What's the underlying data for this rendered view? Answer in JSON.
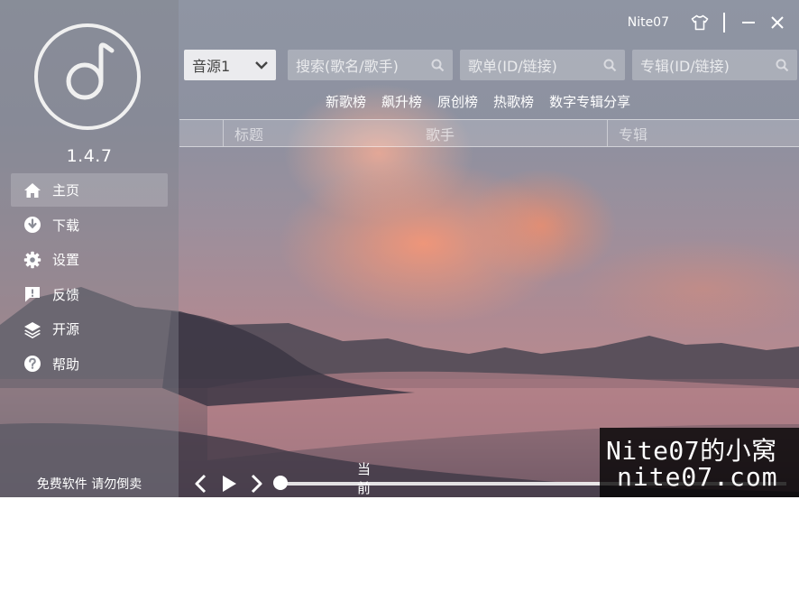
{
  "app": {
    "version": "1.4.7",
    "footer_note": "免费软件 请勿倒卖",
    "accent": "#ffffff"
  },
  "sidebar": {
    "items": [
      {
        "label": "主页",
        "icon": "home-icon",
        "active": true
      },
      {
        "label": "下载",
        "icon": "download-icon",
        "active": false
      },
      {
        "label": "设置",
        "icon": "gear-icon",
        "active": false
      },
      {
        "label": "反馈",
        "icon": "feedback-icon",
        "active": false
      },
      {
        "label": "开源",
        "icon": "layers-icon",
        "active": false
      },
      {
        "label": "帮助",
        "icon": "help-icon",
        "active": false
      }
    ]
  },
  "titlebar": {
    "username": "Nite07"
  },
  "search": {
    "source_value": "音源1",
    "song_placeholder": "搜索(歌名/歌手)",
    "playlist_placeholder": "歌单(ID/链接)",
    "album_placeholder": "专辑(ID/链接)"
  },
  "charts": [
    "新歌榜",
    "飙升榜",
    "原创榜",
    "热歌榜",
    "数字专辑分享"
  ],
  "table": {
    "columns": [
      "标题",
      "歌手",
      "专辑"
    ]
  },
  "player": {
    "now_playing": "当前无播放音乐",
    "progress": 0
  },
  "watermark": {
    "line1": "Nite07的小窝",
    "line2": "nite07.com"
  }
}
